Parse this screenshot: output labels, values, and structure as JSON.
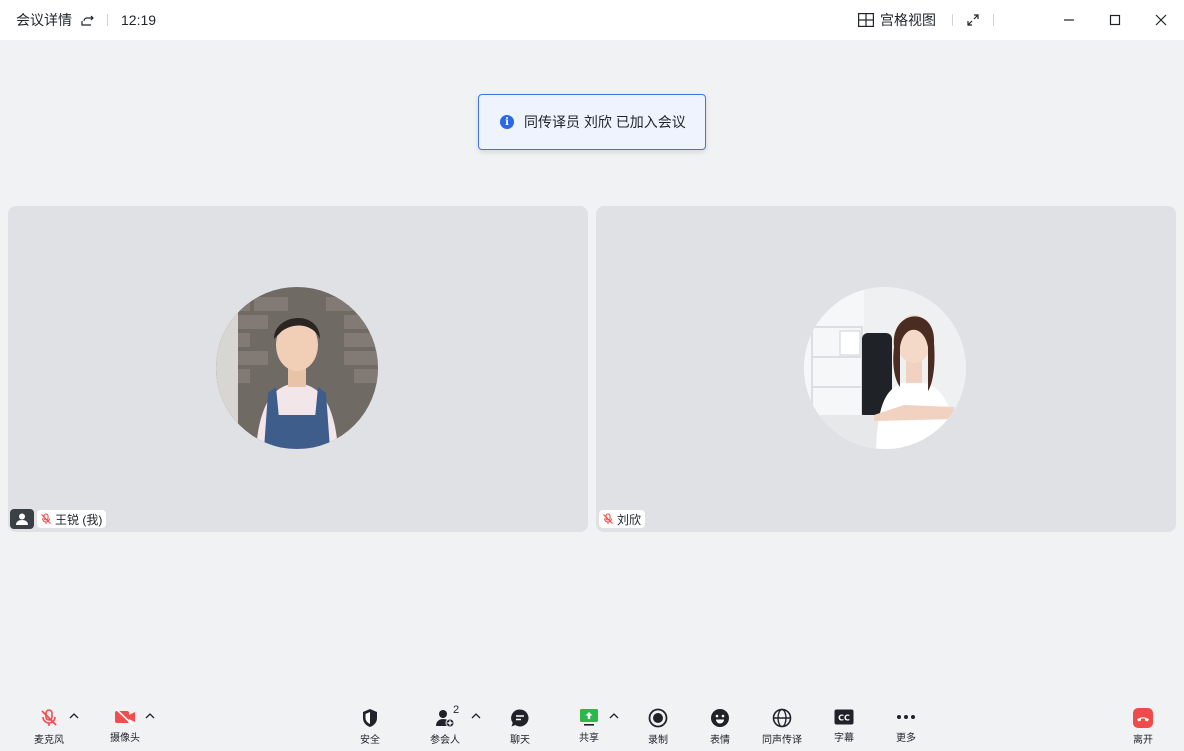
{
  "titlebar": {
    "title": "会议详情",
    "time": "12:19",
    "grid_view_label": "宫格视图"
  },
  "toast": {
    "message": "同传译员 刘欣 已加入会议"
  },
  "tiles": [
    {
      "name": "王锐 (我)",
      "muted": true
    },
    {
      "name": "刘欣",
      "muted": true
    }
  ],
  "toolbar": {
    "mic_label": "麦克风",
    "camera_label": "摄像头",
    "security_label": "安全",
    "participants_label": "参会人",
    "participants_count": "2",
    "chat_label": "聊天",
    "share_label": "共享",
    "record_label": "录制",
    "reaction_label": "表情",
    "interpretation_label": "同声传译",
    "captions_label": "字幕",
    "more_label": "更多",
    "leave_label": "离开"
  },
  "colors": {
    "muted_red": "#f04d4d",
    "share_green": "#2db84d",
    "leave_red": "#f04a4a",
    "accent_blue": "#2b65e8"
  }
}
